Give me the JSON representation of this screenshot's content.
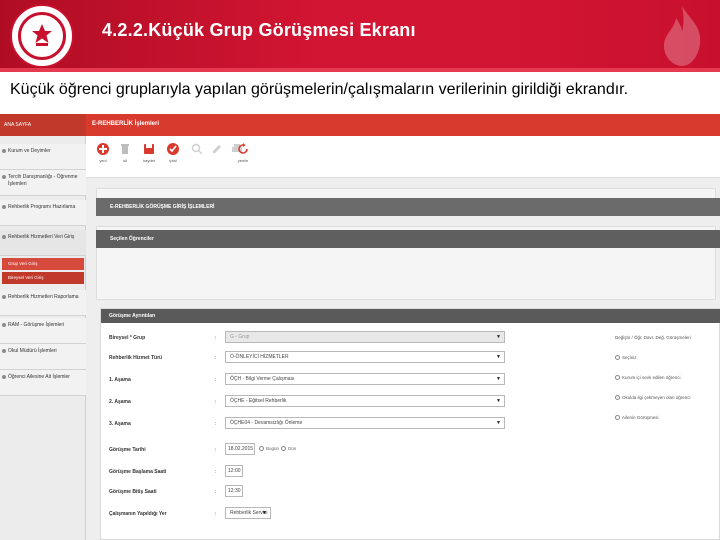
{
  "header": {
    "title": "4.2.2.Küçük  Grup  Görüşmesi  Ekranı",
    "subtitle": "Küçük öğrenci gruplarıyla yapılan görüşmelerin/çalışmaların verilerinin girildiği ekrandır.",
    "brand_color": "#c8102e"
  },
  "app": {
    "topbar_title": "E-REHBERLİK İşlemleri",
    "sidebar": {
      "home": "ANA SAYFA",
      "items": [
        "Kurum ve Deyimler",
        "Tercih Danışmanlığı - Öğrenme İşlemleri",
        "Rehberlik Programı Hazırlama",
        "Rehberlik Hizmetleri Veri Giriş",
        "Rehberlik Hizmetleri Raporlama",
        "RAM - Görüşme İşlemleri",
        "Okul Müdürü İşlemleri",
        "Öğrenci Ailesine Ait İşlemler"
      ],
      "subitems": [
        "Grup Veri Giriş",
        "Bireysel Veri Giriş"
      ]
    },
    "toolbar": [
      {
        "label": "yeni",
        "icon": "plus-icon",
        "color": "#d83a2e"
      },
      {
        "label": "sil",
        "icon": "trash-icon",
        "color": "#bdbdbd"
      },
      {
        "label": "kaydet",
        "icon": "save-icon",
        "color": "#d83a2e"
      },
      {
        "label": "iptal",
        "icon": "check-icon",
        "color": "#d83a2e"
      },
      {
        "label": "",
        "icon": "search-icon",
        "color": "#cfcfcf"
      },
      {
        "label": "",
        "icon": "edit-icon",
        "color": "#cfcfcf"
      },
      {
        "label": "",
        "icon": "print-icon",
        "color": "#cfcfcf"
      },
      {
        "label": "yenile",
        "icon": "refresh-icon",
        "color": "#d83a2e"
      }
    ],
    "sections": {
      "entry_title": "E-REHBERLİK GÖRÜŞME GİRİŞ İŞLEMLERİ",
      "students_title": "Seçilen Öğrenciler",
      "form_title": "Görüşme Ayrıntıları"
    },
    "form": {
      "rows": [
        {
          "label": "Bireysel * Grup",
          "value": "G - Grup",
          "disabled": true
        },
        {
          "label": "Rehberlik Hizmet Türü",
          "value": "Ö-ÖNLEYİCİ HİZMETLER",
          "disabled": false
        },
        {
          "label": "1. Aşama",
          "value": "ÖÇH - Bilgi Verme Çalışması",
          "disabled": false
        },
        {
          "label": "2. Aşama",
          "value": "ÖÇHE - Eğitsel Rehberlik",
          "disabled": false
        },
        {
          "label": "3. Aşama",
          "value": "ÖÇHE04 - Devamsızlığı Önleme",
          "disabled": false
        }
      ],
      "date_label": "Görüşme Tarihi",
      "date_value": "18.02.2015",
      "date_options": [
        "Bugün",
        "Dün"
      ],
      "start_label": "Görüşme Başlama Saati",
      "start_value": "12:00",
      "end_label": "Görüşme Bitiş Saati",
      "end_value": "12:30",
      "place_label": "Çalışmanın Yapıldığı Yer",
      "place_value": "Rehberlik Servisi",
      "right_title": "Değiştir / Öğr. Davr. Değ. Görüşmeleri",
      "right_options": [
        "Seçiniz",
        "Kurum içi sevk edilen öğrenci",
        "Okulda ilgi çekmeyen olan öğrenci",
        "Ailenin Görüşmesi"
      ]
    }
  }
}
